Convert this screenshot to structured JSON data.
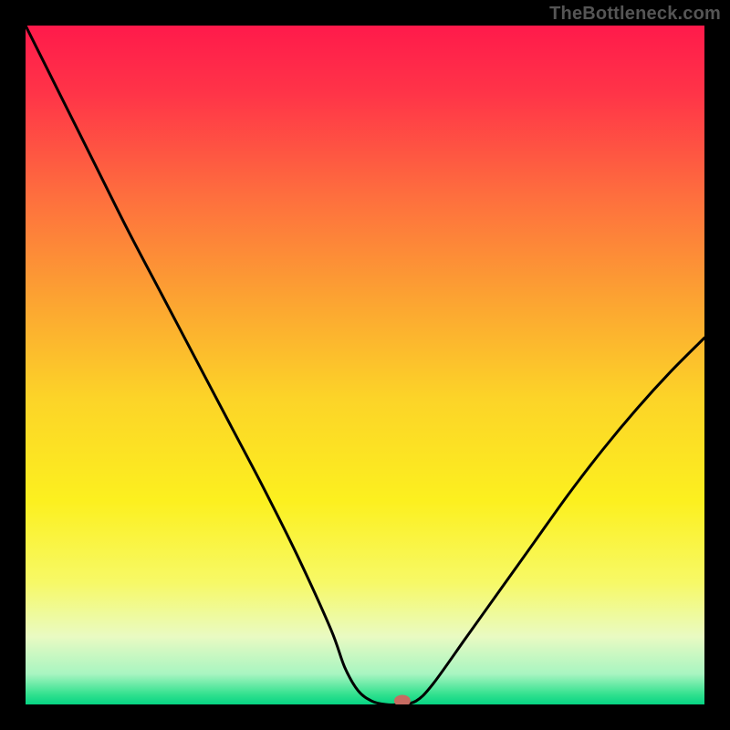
{
  "watermark": "TheBottleneck.com",
  "chart_data": {
    "type": "line",
    "title": "",
    "xlabel": "",
    "ylabel": "",
    "xlim": [
      0,
      1
    ],
    "ylim": [
      0,
      100
    ],
    "x": [
      0.0,
      0.05,
      0.1,
      0.15,
      0.2,
      0.25,
      0.3,
      0.35,
      0.4,
      0.45,
      0.47,
      0.49,
      0.51,
      0.53,
      0.55,
      0.575,
      0.6,
      0.65,
      0.7,
      0.75,
      0.8,
      0.85,
      0.9,
      0.95,
      1.0
    ],
    "values": [
      100,
      90,
      80,
      70,
      60.5,
      51,
      41.5,
      32,
      22,
      11,
      5.5,
      2,
      0.5,
      0,
      0,
      0.5,
      3,
      10,
      17,
      24,
      31,
      37.5,
      43.5,
      49,
      54
    ],
    "marker": {
      "x": 0.555,
      "y": 0
    },
    "background_gradient": {
      "stops": [
        {
          "offset": 0.0,
          "color": "#ff1a4b"
        },
        {
          "offset": 0.1,
          "color": "#ff3448"
        },
        {
          "offset": 0.25,
          "color": "#fe6e3e"
        },
        {
          "offset": 0.4,
          "color": "#fca232"
        },
        {
          "offset": 0.55,
          "color": "#fcd428"
        },
        {
          "offset": 0.7,
          "color": "#fcf01f"
        },
        {
          "offset": 0.82,
          "color": "#f7f966"
        },
        {
          "offset": 0.9,
          "color": "#e9fac2"
        },
        {
          "offset": 0.955,
          "color": "#a8f5c1"
        },
        {
          "offset": 0.985,
          "color": "#33e18f"
        },
        {
          "offset": 1.0,
          "color": "#06d483"
        }
      ]
    }
  }
}
